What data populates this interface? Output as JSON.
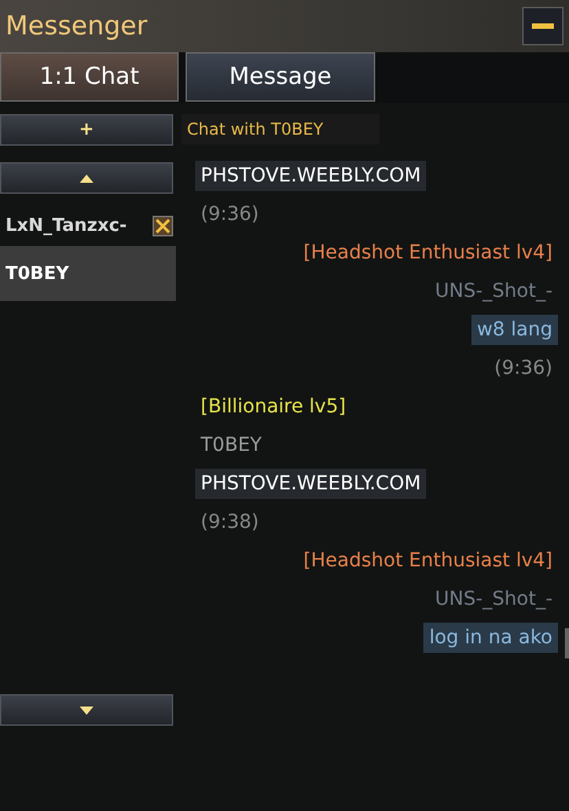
{
  "window": {
    "title": "Messenger"
  },
  "tabs": [
    {
      "label": "1:1 Chat",
      "selected": true
    },
    {
      "label": "Message",
      "selected": false
    }
  ],
  "add_button": "+",
  "chat_title": "Chat with T0BEY",
  "contacts": [
    {
      "name": "LxN_Tanzxc-",
      "selected": false,
      "closable": true
    },
    {
      "name": "T0BEY",
      "selected": true,
      "closable": false
    }
  ],
  "messages": [
    {
      "kind": "text",
      "outgoing": false,
      "text": "PHSTOVE.WEEBLY.COM"
    },
    {
      "kind": "time",
      "outgoing": false,
      "text": "(9:36)"
    },
    {
      "kind": "title",
      "outgoing": true,
      "text": "[Headshot Enthusiast lv4]",
      "color": "#e8804a"
    },
    {
      "kind": "name",
      "outgoing": true,
      "text": "UNS-_Shot_-"
    },
    {
      "kind": "text",
      "outgoing": true,
      "text": "w8 lang"
    },
    {
      "kind": "time",
      "outgoing": true,
      "text": "(9:36)"
    },
    {
      "kind": "title",
      "outgoing": false,
      "text": "[Billionaire lv5]",
      "color": "#e6e24a"
    },
    {
      "kind": "name",
      "outgoing": false,
      "text": "T0BEY"
    },
    {
      "kind": "text",
      "outgoing": false,
      "text": "PHSTOVE.WEEBLY.COM"
    },
    {
      "kind": "time",
      "outgoing": false,
      "text": "(9:38)"
    },
    {
      "kind": "title",
      "outgoing": true,
      "text": "[Headshot Enthusiast lv4]",
      "color": "#e8804a"
    },
    {
      "kind": "name",
      "outgoing": true,
      "text": "UNS-_Shot_-"
    },
    {
      "kind": "text",
      "outgoing": true,
      "text": "log in na ako"
    }
  ]
}
